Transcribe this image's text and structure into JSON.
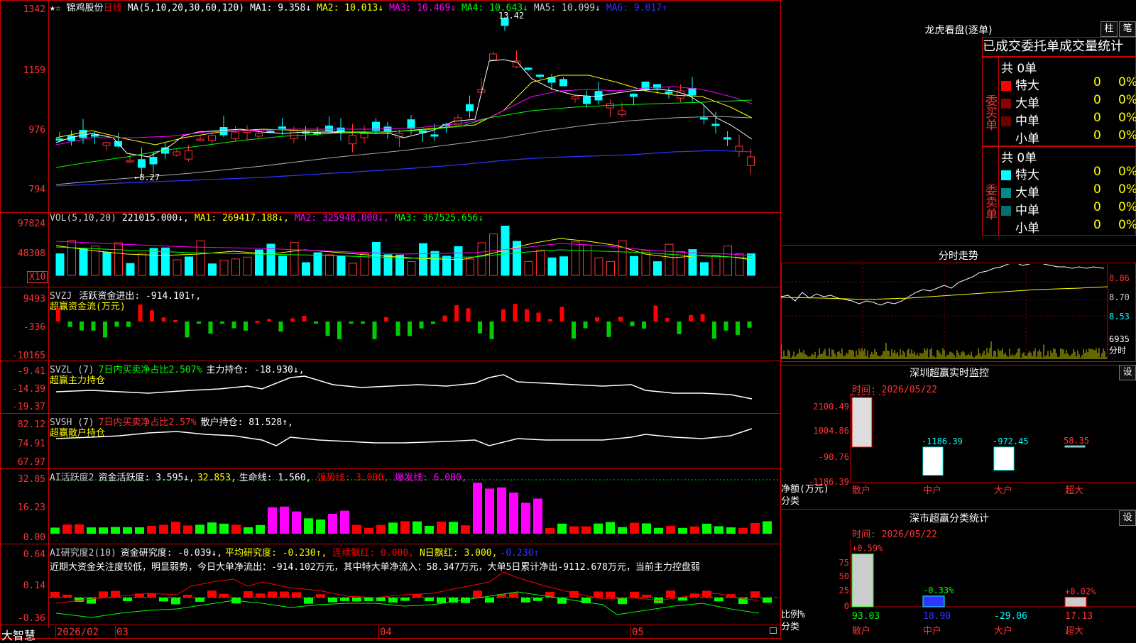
{
  "stock": {
    "name": "锦鸡股份",
    "period": "日线",
    "star": "★",
    "star2": "☆",
    "ma_label": "MA(5,10,20,30,60,120)",
    "ma1": "MA1: 9.358↓",
    "ma2": "MA2: 10.013↓",
    "ma3": "MA3: 10.469↓",
    "ma4": "MA4: 10.643↓",
    "ma5": "MA5: 10.099↓",
    "ma6": "MA6: 9.017↑",
    "high_mark": "13.42",
    "low_mark": "←8.27",
    "yticks": [
      "1342",
      "1159",
      "976",
      "794"
    ]
  },
  "vol": {
    "label": "VOL(5,10,20)",
    "value": "221015.000↓,",
    "ma1": "MA1: 269417.188↓,",
    "ma2": "MA2: 325948.000↓,",
    "ma3": "MA3: 367525.656↓",
    "yticks": [
      "97824",
      "48308"
    ],
    "unit": "X10"
  },
  "svzj": {
    "label": "SVZJ",
    "desc": "活跃资金进出: -914.101↑,",
    "sub": "超赢资金流(万元)",
    "yticks": [
      "9493",
      "-336",
      "-10165"
    ]
  },
  "svzl": {
    "label": "SVZL (7)",
    "desc1": "7日内买卖净占比2.507%",
    "desc2": "主力持仓: -18.930↓,",
    "sub": "超赢主力持仓",
    "yticks": [
      "-9.41",
      "-14.39",
      "-19.37"
    ]
  },
  "svsh": {
    "label": "SVSH (7)",
    "desc1": "7日内买卖净占比2.57%",
    "desc2": "散户持仓: 81.528↑,",
    "sub": "超赢散户持仓",
    "yticks": [
      "82.12",
      "74.91",
      "67.97"
    ]
  },
  "ai1": {
    "label": "AI活跃度2",
    "desc": "资金活跃度: 3.595↓,",
    "v2": "32.853,",
    "life": "生命线: 1.560,",
    "strong": "强势线: 3.000,",
    "burst": "爆发线: 6.000,",
    "yticks": [
      "32.85",
      "16.23",
      "0.00"
    ]
  },
  "ai2": {
    "label": "AI研究度2(10)",
    "desc": "资金研究度: -0.039↓,",
    "avg": "平均研究度: -0.230↑,",
    "red": "连续飘红: 0.000,",
    "nred": "N日飘红: 3.000,",
    "val": "-0.230↑",
    "note": "近期大资金关注度较低，明显弱势，今日大单净流出：-914.102万元，其中特大单净流入：58.347万元，大单5日累计净出-9112.678万元，当前主力控盘弱",
    "yticks": [
      "0.64",
      "0.14",
      "-0.36"
    ]
  },
  "xaxis": {
    "brand": "大智慧",
    "labels": [
      "2026/02",
      "03",
      "04",
      "05"
    ]
  },
  "lhb": {
    "title": "龙虎看盘(逐单)",
    "btn1": "柱",
    "btn2": "笔",
    "tabs": "已成交委托单成交量统计",
    "buy_label": "委买单",
    "sell_label": "委卖单",
    "buy_total": "共 0单",
    "sell_total": "共 0单",
    "rows": [
      {
        "name": "特大",
        "v": "0",
        "p": "0%"
      },
      {
        "name": "大单",
        "v": "0",
        "p": "0%"
      },
      {
        "name": "中单",
        "v": "0",
        "p": "0%"
      },
      {
        "name": "小单",
        "v": "0",
        "p": "0%"
      }
    ],
    "buy_colors": [
      "#ff0000",
      "#8b0000",
      "#6b0000",
      "#000000"
    ],
    "sell_colors": [
      "#00ffff",
      "#008b8b",
      "#007070",
      "#000000"
    ]
  },
  "intraday": {
    "title": "分时走势",
    "prices": [
      "8.86",
      "8.70",
      "8.53"
    ],
    "vol": "6935",
    "vol_unit": "分时"
  },
  "monitor": {
    "title": "深圳超赢实时监控",
    "set": "设",
    "time": "时间: 2026/05/22",
    "yticks": [
      "2100.49",
      "1004.86",
      "-90.76",
      "-1186.39"
    ],
    "ylabel": "净额(万元)",
    "xlabel": "分类",
    "categories": [
      "散户",
      "中户",
      "大户",
      "超大"
    ],
    "values": [
      "2100.49",
      "-1186.39",
      "-972.45",
      "58.35"
    ]
  },
  "stats": {
    "title": "深市超赢分类统计",
    "set": "设",
    "time": "时间: 2026/05/22",
    "yticks": [
      "75",
      "50",
      "25",
      "0"
    ],
    "ylabel": "比例%",
    "xlabel": "分类",
    "categories": [
      "散户",
      "中户",
      "大户",
      "超大"
    ],
    "pct": [
      "+0.59%",
      "-0.33%",
      "",
      "+0.02%"
    ],
    "values": [
      "93.03",
      "18.90",
      "-29.06",
      "17.13"
    ]
  }
}
